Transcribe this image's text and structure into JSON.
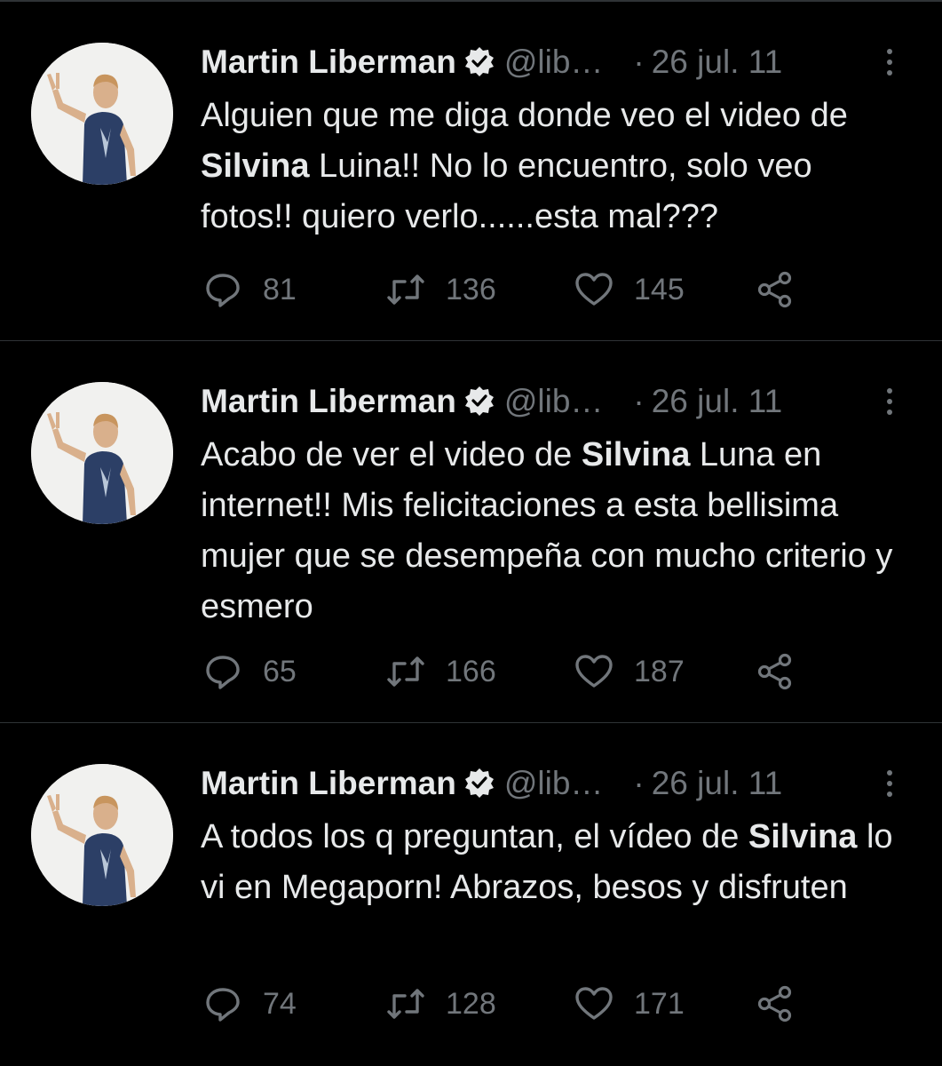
{
  "tweets": [
    {
      "author_name": "Martin Liberman",
      "handle": "@lib…",
      "separator": "·",
      "date": "26 jul. 11",
      "text_parts": [
        "Alguien que me diga donde veo el video de ",
        "Silvina",
        " Luina!! No lo encuentro, solo veo fotos!! quiero verlo......esta mal???"
      ],
      "replies": "81",
      "retweets": "136",
      "likes": "145"
    },
    {
      "author_name": "Martin Liberman",
      "handle": "@lib…",
      "separator": "·",
      "date": "26 jul. 11",
      "text_parts": [
        "Acabo de ver el video de ",
        "Silvina",
        " Luna en internet!! Mis felicitaciones a esta bellisima mujer que se desempeña con mucho criterio y esmero"
      ],
      "replies": "65",
      "retweets": "166",
      "likes": "187"
    },
    {
      "author_name": "Martin Liberman",
      "handle": "@lib…",
      "separator": "·",
      "date": "26 jul. 11",
      "text_parts": [
        "A todos los q preguntan, el vídeo de ",
        "Silvina",
        " lo vi en Megaporn! Abrazos, besos y disfruten"
      ],
      "replies": "74",
      "retweets": "128",
      "likes": "171"
    }
  ],
  "colors": {
    "background": "#000000",
    "text": "#e7e9ea",
    "muted": "#71767b",
    "divider": "#2f3336",
    "avatar_bg": "#f1f1ef",
    "shirt": "#2c3f66"
  },
  "icons": {
    "verified": "verified-badge-icon",
    "more": "more-dots-icon",
    "reply": "reply-icon",
    "retweet": "retweet-icon",
    "like": "heart-icon",
    "share": "share-icon"
  }
}
